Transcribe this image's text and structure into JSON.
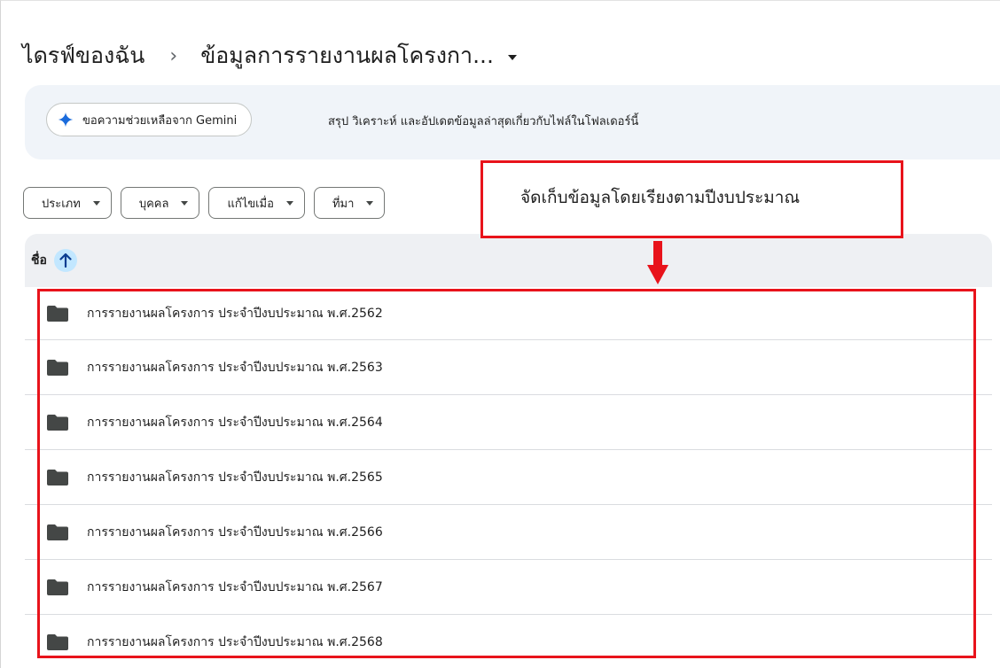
{
  "breadcrumb": {
    "root": "ไดรฟ์ของฉัน",
    "separator": "›",
    "current": "ข้อมูลการรายงานผลโครงกา..."
  },
  "gemini": {
    "chip_label": "ขอความช่วยเหลือจาก Gemini",
    "description": "สรุป วิเคราะห์ และอัปเดตข้อมูลล่าสุดเกี่ยวกับไฟล์ในโฟลเดอร์นี้"
  },
  "filters": [
    {
      "label": "ประเภท"
    },
    {
      "label": "บุคคล"
    },
    {
      "label": "แก้ไขเมื่อ"
    },
    {
      "label": "ที่มา"
    }
  ],
  "table": {
    "name_header": "ชื่อ",
    "sort_icon": "arrow-up-icon",
    "rows": [
      {
        "name": "การรายงานผลโครงการ ประจำปีงบประมาณ พ.ศ.2562",
        "icon": "folder-icon"
      },
      {
        "name": "การรายงานผลโครงการ ประจำปีงบประมาณ พ.ศ.2563",
        "icon": "folder-icon"
      },
      {
        "name": "การรายงานผลโครงการ ประจำปีงบประมาณ พ.ศ.2564",
        "icon": "folder-icon"
      },
      {
        "name": "การรายงานผลโครงการ ประจำปีงบประมาณ พ.ศ.2565",
        "icon": "folder-icon"
      },
      {
        "name": "การรายงานผลโครงการ ประจำปีงบประมาณ พ.ศ.2566",
        "icon": "folder-icon"
      },
      {
        "name": "การรายงานผลโครงการ ประจำปีงบประมาณ พ.ศ.2567",
        "icon": "folder-icon"
      },
      {
        "name": "การรายงานผลโครงการ ประจำปีงบประมาณ พ.ศ.2568",
        "icon": "folder-icon"
      }
    ]
  },
  "annotation": {
    "callout_text": "จัดเก็บข้อมูลโดยเรียงตามปีงบประมาณ",
    "color": "#e8131b"
  },
  "colors": {
    "banner_bg": "#f0f4f9",
    "sort_badge": "#c2e7ff",
    "header_bg": "#eef0f3",
    "folder": "#444746"
  }
}
